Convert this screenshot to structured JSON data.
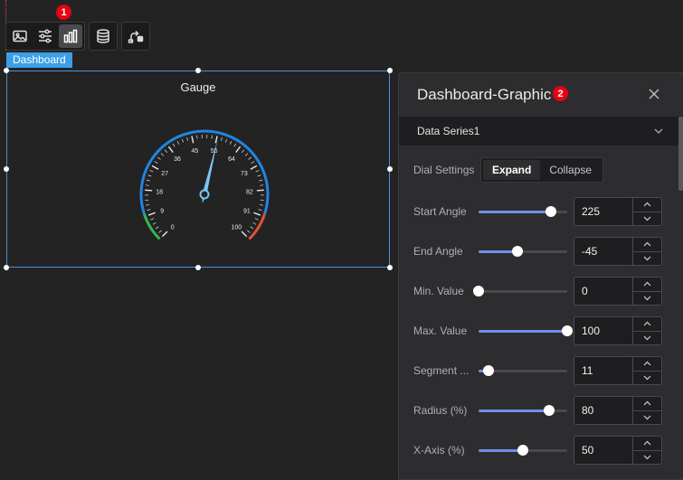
{
  "markers": {
    "one": "1",
    "two": "2"
  },
  "toolbar": {
    "group1": [
      "image-icon",
      "sliders-icon",
      "bar-chart-icon"
    ],
    "group2": [
      "database-icon"
    ],
    "group3": [
      "link-switch-icon"
    ]
  },
  "component": {
    "tag": "Dashboard",
    "title": "Gauge"
  },
  "gauge": {
    "min": 0,
    "max": 100,
    "value": 55,
    "start_angle": 225,
    "end_angle": -45,
    "tick_labels": [
      "0",
      "9",
      "18",
      "27",
      "36",
      "45",
      "55",
      "64",
      "73",
      "82",
      "91",
      "100"
    ],
    "colors": {
      "arc": "#1f86e0",
      "low": "#3ab54a",
      "high": "#e05038",
      "pointer": "#7cc4f5"
    }
  },
  "panel": {
    "title": "Dashboard-Graphic",
    "series": "Data Series1",
    "dial_settings": {
      "label": "Dial Settings",
      "expand": "Expand",
      "collapse": "Collapse"
    },
    "fields": [
      {
        "label": "Start Angle",
        "value": "225",
        "slider": 0.82
      },
      {
        "label": "End Angle",
        "value": "-45",
        "slider": 0.44
      },
      {
        "label": "Min. Value",
        "value": "0",
        "slider": 0.0
      },
      {
        "label": "Max. Value",
        "value": "100",
        "slider": 1.0
      },
      {
        "label": "Segment ...",
        "value": "11",
        "slider": 0.11
      },
      {
        "label": "Radius (%)",
        "value": "80",
        "slider": 0.8
      },
      {
        "label": "X-Axis (%)",
        "value": "50",
        "slider": 0.5
      }
    ]
  }
}
